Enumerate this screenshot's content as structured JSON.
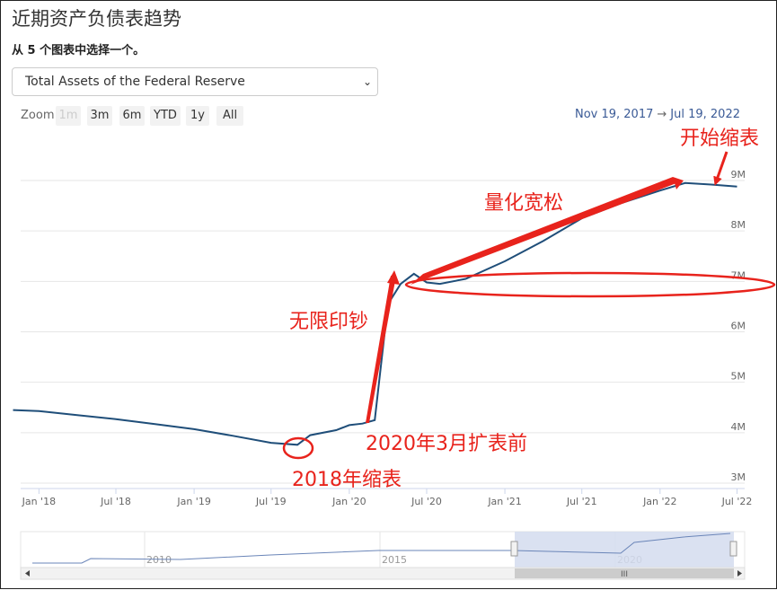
{
  "page": {
    "title": "近期资产负债表趋势",
    "subtitle": "从 5 个图表中选择一个。",
    "select_value": "Total Assets of the Federal Reserve"
  },
  "zoom": {
    "label": "Zoom",
    "buttons": [
      "1m",
      "3m",
      "6m",
      "YTD",
      "1y",
      "All"
    ],
    "disabled": "1m"
  },
  "range": {
    "from": "Nov 19, 2017",
    "arrow": "→",
    "to": "Jul 19, 2022"
  },
  "chart_data": {
    "type": "line",
    "x_ticks": [
      "Jan '18",
      "Jul '18",
      "Jan '19",
      "Jul '19",
      "Jan '20",
      "Jul '20",
      "Jan '21",
      "Jul '21",
      "Jan '22",
      "Jul '22"
    ],
    "y_ticks": [
      "3M",
      "4M",
      "5M",
      "6M",
      "7M",
      "8M",
      "9M"
    ],
    "ylim": [
      3,
      9
    ],
    "series": [
      {
        "x": [
          "2017-11",
          "2018-01",
          "2018-04",
          "2018-07",
          "2018-10",
          "2019-01",
          "2019-04",
          "2019-07",
          "2019-09",
          "2019-10",
          "2019-12",
          "2020-01",
          "2020-02",
          "2020-03-01",
          "2020-03-15",
          "2020-04",
          "2020-05",
          "2020-06",
          "2020-07",
          "2020-08",
          "2020-10",
          "2021-01",
          "2021-04",
          "2021-07",
          "2021-10",
          "2022-01",
          "2022-03",
          "2022-05",
          "2022-07"
        ],
        "values": [
          4.45,
          4.43,
          4.35,
          4.27,
          4.17,
          4.07,
          3.94,
          3.8,
          3.76,
          3.95,
          4.05,
          4.15,
          4.18,
          4.25,
          5.3,
          6.55,
          6.95,
          7.15,
          6.98,
          6.95,
          7.05,
          7.4,
          7.8,
          8.25,
          8.55,
          8.8,
          8.95,
          8.92,
          8.88
        ],
        "color": "#1f4e79"
      }
    ],
    "annotations": [
      "开始缩表",
      "量化宽松",
      "无限印钞",
      "2020年3月扩表前",
      "2018年缩表"
    ],
    "navigator": {
      "ticks": [
        "2010",
        "2015",
        "2020"
      ],
      "handle_label": "III"
    }
  },
  "colors": {
    "line": "#1f4e79",
    "annotation": "#e8231c",
    "navigator_fill": "#d3dcee"
  }
}
